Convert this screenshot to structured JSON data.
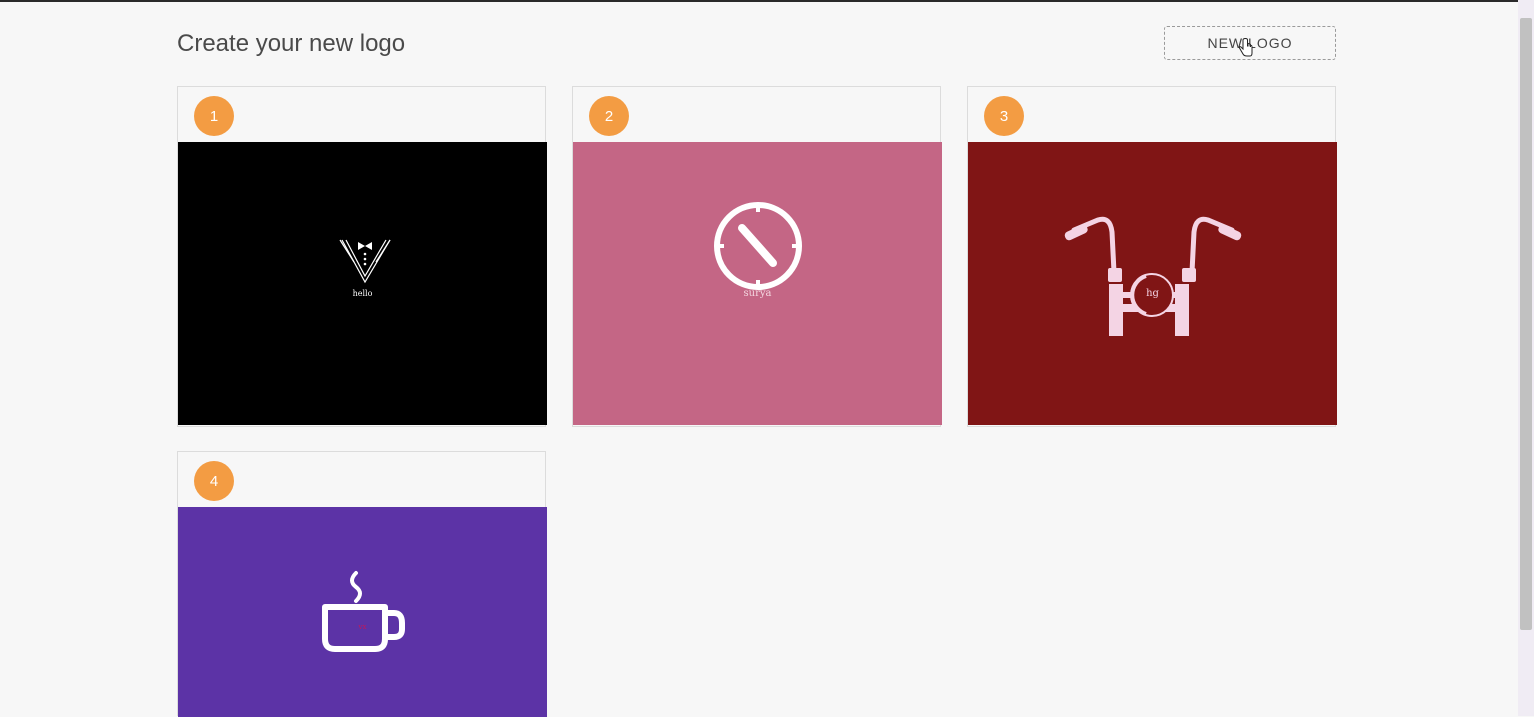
{
  "header": {
    "title": "Create your new logo",
    "new_logo_label": "NEW LOGO"
  },
  "logos": [
    {
      "number": "1",
      "caption": "hello",
      "background": "#000000",
      "icon": "tuxedo-icon"
    },
    {
      "number": "2",
      "caption": "surya",
      "background": "#c46685",
      "icon": "compass-icon"
    },
    {
      "number": "3",
      "caption": "hg",
      "background": "#801515",
      "icon": "motorcycle-handlebar-icon"
    },
    {
      "number": "4",
      "caption": "vx",
      "background": "#5c33a6",
      "icon": "coffee-cup-icon"
    }
  ]
}
